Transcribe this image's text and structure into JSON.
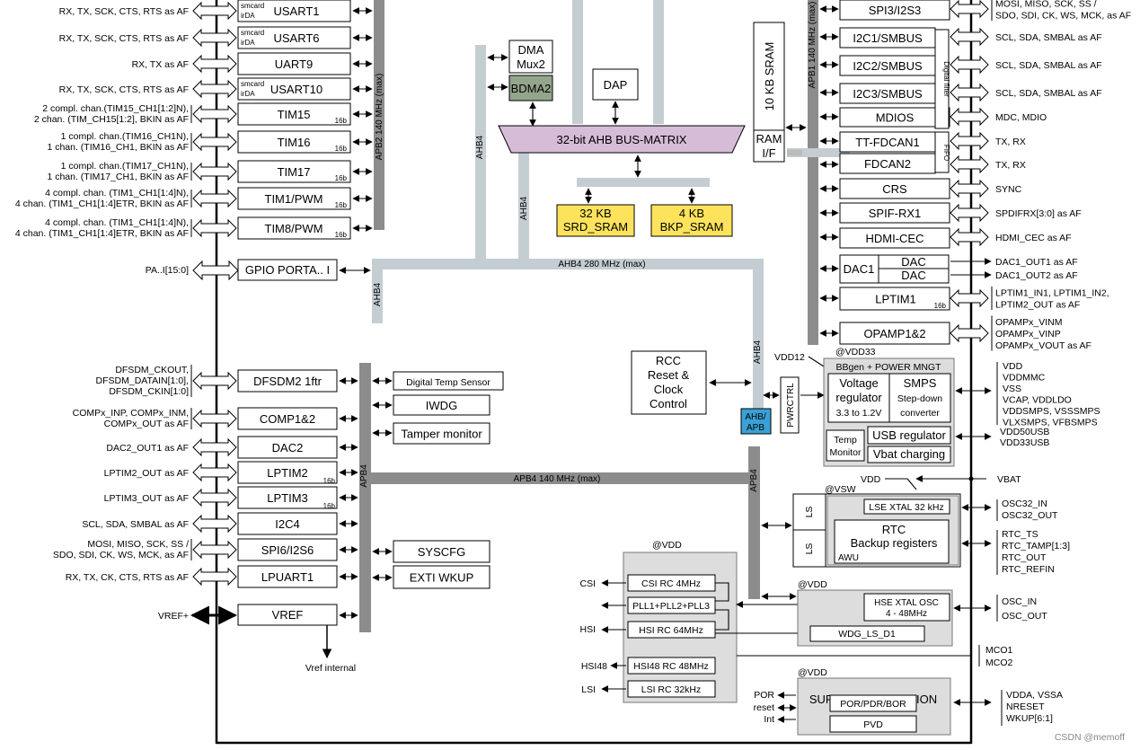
{
  "watermark": "CSDN @memoff",
  "buses": {
    "apb2": "APB2 140 MHz (max)",
    "apb1": "APB1 140 MHz (max)",
    "apb4_h": "APB4   140 MHz (max)",
    "apb4_v": "APB4",
    "apb4_r": "APB4",
    "ahb4_main": "AHB4 280 MHz (max)",
    "ahb4_a": "AHB4",
    "ahb4_b": "AHB4",
    "ahb4_c": "AHB4",
    "ahb4_d": "AHB4",
    "ahb_apb": [
      "AHB/",
      "APB"
    ]
  },
  "left_apb2": [
    {
      "label": "USART1",
      "small": [
        "smcard",
        "irDA"
      ],
      "badge": "",
      "signals": [
        "RX, TX, SCK, CTS, RTS as AF"
      ]
    },
    {
      "label": "USART6",
      "small": [
        "smcard",
        "irDA"
      ],
      "badge": "",
      "signals": [
        "RX, TX, SCK, CTS, RTS as AF"
      ]
    },
    {
      "label": "UART9",
      "small": [],
      "badge": "",
      "signals": [
        "RX, TX as AF"
      ]
    },
    {
      "label": "USART10",
      "small": [
        "smcard",
        "irDA"
      ],
      "badge": "",
      "signals": [
        "RX, TX, SCK, CTS, RTS as AF"
      ]
    },
    {
      "label": "TIM15",
      "small": [],
      "badge": "16b",
      "signals": [
        "2 compl. chan.(TIM15_CH1[1:2]N),",
        "2 chan. (TIM_CH15[1:2], BKIN as AF"
      ]
    },
    {
      "label": "TIM16",
      "small": [],
      "badge": "16b",
      "signals": [
        "1 compl. chan.(TIM16_CH1N),",
        "1 chan. (TIM16_CH1, BKIN as AF"
      ]
    },
    {
      "label": "TIM17",
      "small": [],
      "badge": "16b",
      "signals": [
        "1 compl. chan.(TIM17_CH1N),",
        "1 chan. (TIM17_CH1, BKIN as AF"
      ]
    },
    {
      "label": "TIM1/PWM",
      "small": [],
      "badge": "16b",
      "signals": [
        "4 compl. chan. (TIM1_CH1[1:4]N),",
        "4 chan. (TIM1_CH1[1:4]ETR, BKIN as AF"
      ]
    },
    {
      "label": "TIM8/PWM",
      "small": [],
      "badge": "16b",
      "signals": [
        "4 compl. chan. (TIM1_CH1[1:4]N),",
        "4 chan. (TIM1_CH1[1:4]ETR, BKIN as AF"
      ]
    }
  ],
  "gpio": {
    "label": "GPIO PORTA.. I",
    "signal": "PA..I[15:0]"
  },
  "left_apb4": [
    {
      "label": "DFSDM2 1ftr",
      "badge": "",
      "signals": [
        "DFSDM_CKOUT,",
        "DFSDM_DATAIN[1:0],",
        "DFSDM_CKIN[1:0]"
      ]
    },
    {
      "label": "COMP1&2",
      "badge": "",
      "signals": [
        "COMPx_INP, COMPx_INM,",
        "COMPx_OUT as AF"
      ]
    },
    {
      "label": "DAC2",
      "badge": "",
      "signals": [
        "DAC2_OUT1 as AF"
      ]
    },
    {
      "label": "LPTIM2",
      "badge": "16b",
      "signals": [
        "LPTIM2_OUT as AF"
      ]
    },
    {
      "label": "LPTIM3",
      "badge": "16b",
      "signals": [
        "LPTIM3_OUT as AF"
      ]
    },
    {
      "label": "I2C4",
      "badge": "",
      "signals": [
        "SCL, SDA, SMBAL as AF"
      ]
    },
    {
      "label": "SPI6/I2S6",
      "badge": "",
      "signals": [
        "MOSI, MISO, SCK, SS /",
        "SDO, SDI, CK, WS, MCK, as AF"
      ]
    },
    {
      "label": "LPUART1",
      "badge": "",
      "signals": [
        "RX, TX, CK, CTS, RTS as AF"
      ]
    }
  ],
  "vref": {
    "label": "VREF",
    "signal": "VREF+",
    "out": "Vref internal"
  },
  "apb4_right": [
    "Digital Temp Sensor",
    "IWDG",
    "Tamper monitor",
    "SYSCFG",
    "EXTI WKUP"
  ],
  "center": {
    "dma": [
      "DMA",
      "Mux2"
    ],
    "bdma": "BDMA2",
    "dap": "DAP",
    "matrix": "32-bit AHB BUS-MATRIX",
    "srd": [
      "32 KB",
      "SRD_SRAM"
    ],
    "bkp": [
      "4 KB",
      "BKP_SRAM"
    ],
    "sram10": "10 KB SRAM",
    "ramif": [
      "RAM",
      "I/F"
    ],
    "rcc": [
      "RCC",
      "Reset &",
      "Clock",
      "Control"
    ],
    "pwrctrl": "PWRCTRL"
  },
  "right_apb1": [
    {
      "label": "SPI3/I2S3",
      "signals": [
        "MOSI, MISO, SCK, SS /",
        "SDO, SDI, CK, WS, MCK, as AF"
      ]
    },
    {
      "label": "I2C1/SMBUS",
      "signals": [
        "SCL, SDA, SMBAL as AF"
      ]
    },
    {
      "label": "I2C2/SMBUS",
      "signals": [
        "SCL, SDA, SMBAL as AF"
      ]
    },
    {
      "label": "I2C3/SMBUS",
      "signals": [
        "SCL, SDA, SMBAL as AF"
      ]
    },
    {
      "label": "MDIOS",
      "signals": [
        "MDC, MDIO"
      ]
    },
    {
      "label": "TT-FDCAN1",
      "signals": [
        "TX, RX"
      ]
    },
    {
      "label": "FDCAN2",
      "signals": [
        "TX, RX"
      ]
    },
    {
      "label": "CRS",
      "signals": [
        "SYNC"
      ]
    },
    {
      "label": "SPIF-RX1",
      "signals": [
        "SPDIFRX[3:0] as AF"
      ]
    },
    {
      "label": "HDMI-CEC",
      "signals": [
        "HDMI_CEC as AF"
      ]
    },
    {
      "label": "LPTIM1",
      "signals": [
        "LPTIM1_IN1, LPTIM1_IN2,",
        "LPTIM2_OUT as AF"
      ]
    },
    {
      "label": "OPAMP1&2",
      "signals": [
        "OPAMPx_VINM",
        "OPAMPx_VINP",
        "OPAMPx_VOUT as AF"
      ]
    }
  ],
  "digital_filter": "Digital filter",
  "fifo": "FIFO",
  "dac1": {
    "label": "DAC1",
    "sub": [
      "DAC",
      "DAC"
    ],
    "signals": [
      "DAC1_OUT1 as AF",
      "DAC1_OUT2 as AF"
    ]
  },
  "badge16": "16b",
  "power": {
    "domain": "@VDD33",
    "title": "BBgen + POWER MNGT",
    "regulator": [
      "Voltage",
      "regulator",
      "3.3 to 1.2V"
    ],
    "smps": [
      "SMPS",
      "Step-down",
      "converter"
    ],
    "temp": [
      "Temp",
      "Monitor"
    ],
    "usb": "USB regulator",
    "vbat": "Vbat charging",
    "vdd12": "VDD12",
    "signals": [
      "VDD",
      "VDDMMC",
      "VSS",
      "VCAP, VDDLDO",
      "VDDSMPS, VSSSMPS",
      "VLXSMPS, VFBSMPS"
    ],
    "usb_signals": [
      "VDD50USB",
      "VDD33USB"
    ]
  },
  "vsw": {
    "domain": "@VSW",
    "vdd": "VDD",
    "vbat": "VBAT",
    "ls": [
      "LS",
      "LS"
    ],
    "lse": "LSE XTAL 32 kHz",
    "rtc": [
      "RTC",
      "Backup registers"
    ],
    "awu": "AWU",
    "signals_osc": [
      "OSC32_IN",
      "OSC32_OUT"
    ],
    "signals_rtc": [
      "RTC_TS",
      "RTC_TAMP[1:3]",
      "RTC_OUT",
      "RTC_REFIN"
    ]
  },
  "clocks": {
    "domain": "@VDD",
    "items": [
      "CSI RC  4MHz",
      "PLL1+PLL2+PLL3",
      "HSI RC  64MHz",
      "HSI48 RC  48MHz",
      "LSI RC  32kHz"
    ],
    "left_labels": [
      "CSI",
      "HSI",
      "HSI48",
      "LSI"
    ]
  },
  "hse": {
    "domain": "@VDD",
    "box": [
      "HSE XTAL OSC",
      "4 - 48MHz"
    ],
    "wdg": "WDG_LS_D1",
    "signals": [
      "OSC_IN",
      "OSC_OUT"
    ],
    "mco": [
      "MCO1",
      "MCO2"
    ]
  },
  "supply": {
    "domain": "@VDD",
    "title": "SUPPLY SUPERVISION",
    "por": "POR/PDR/BOR",
    "pvd": "PVD",
    "left": [
      "POR",
      "reset",
      "Int"
    ],
    "signals": [
      "VDDA, VSSA",
      "NRESET",
      "WKUP[6:1]"
    ]
  }
}
